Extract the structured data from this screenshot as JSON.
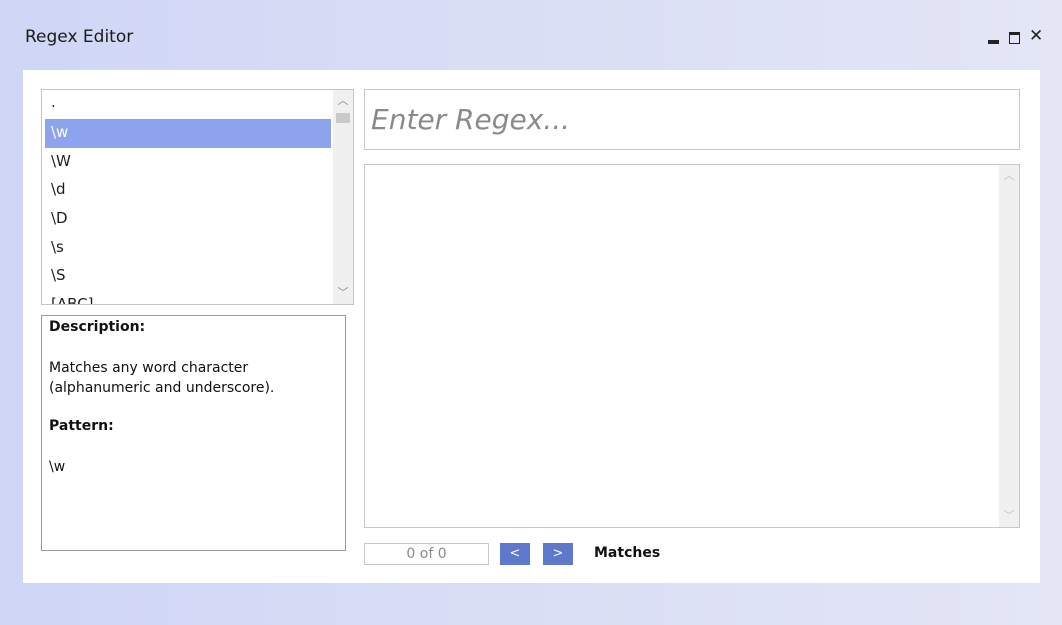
{
  "window": {
    "title": "Regex Editor",
    "minimize_icon": "minimize-icon",
    "maximize_icon": "maximize-icon",
    "close_icon": "close-icon",
    "close_glyph": "✕"
  },
  "tokens": {
    "items": [
      ".",
      "\\w",
      "\\W",
      "\\d",
      "\\D",
      "\\s",
      "\\S",
      "[ABC]"
    ],
    "selected_index": 1
  },
  "description": {
    "description_label": "Description:",
    "description_text": "Matches any word character (alphanumeric and underscore).",
    "pattern_label": "Pattern:",
    "pattern_value": "\\w"
  },
  "regex": {
    "placeholder": "Enter Regex...",
    "value": ""
  },
  "test_text": {
    "value": ""
  },
  "matches": {
    "counter": "0 of 0",
    "prev_label": "<",
    "next_label": ">",
    "label": "Matches"
  },
  "colors": {
    "selected_row": "#8ea3ee",
    "nav_button": "#5e78cc",
    "background": "#d4daf5"
  }
}
